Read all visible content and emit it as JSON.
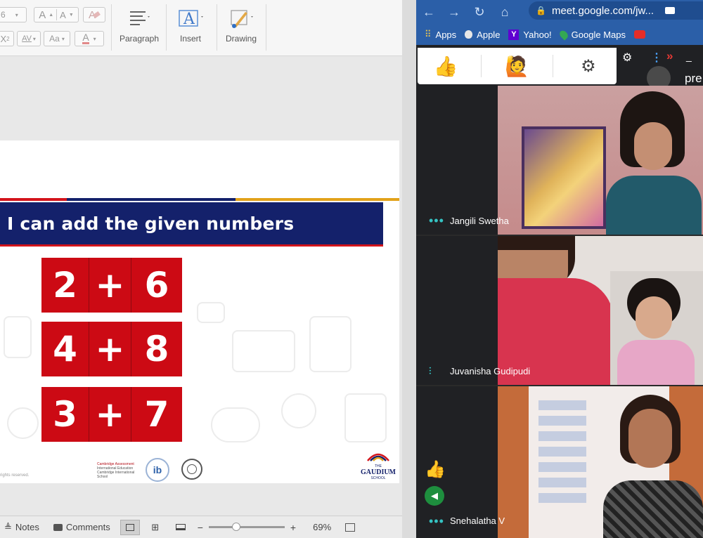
{
  "ppt": {
    "ribbon": {
      "font_size_value": "6",
      "grow_label": "A",
      "shrink_label": "A",
      "clear_label": "A",
      "sub_label": "X",
      "char_spacing_label": "AV",
      "change_case_label": "Aa",
      "font_color_label": "A",
      "paragraph_label": "Paragraph",
      "insert_label": "Insert",
      "drawing_label": "Drawing"
    },
    "slide": {
      "title": "I can add the given numbers",
      "equations": [
        {
          "a": "2",
          "op": "+",
          "b": "6"
        },
        {
          "a": "4",
          "op": "+",
          "b": "8"
        },
        {
          "a": "3",
          "op": "+",
          "b": "7"
        }
      ],
      "rights_note": "rights reserved.",
      "school_name": "GAUDIUM",
      "school_prefix": "THE",
      "school_suffix": "SCHOOL",
      "cambridge_line1": "Cambridge Assessment",
      "cambridge_line2": "International Education",
      "cambridge_line3": "Cambridge International School",
      "ib_label": "ib"
    },
    "statusbar": {
      "notes_label": "Notes",
      "comments_label": "Comments",
      "zoom_minus": "−",
      "zoom_plus": "+",
      "zoom_level": "69%",
      "zoom_fraction": 0.36
    }
  },
  "browser": {
    "url": "meet.google.com/jw...",
    "bookmarks": [
      {
        "label": "Apps",
        "icon": "apps-grid-icon"
      },
      {
        "label": "Apple",
        "icon": "apple-icon"
      },
      {
        "label": "Yahoo!",
        "icon": "yahoo-icon"
      },
      {
        "label": "Google Maps",
        "icon": "maps-pin-icon"
      }
    ],
    "presenting_label": "pre"
  },
  "meet": {
    "participants": [
      {
        "name": "Jangili Swetha",
        "indicator": "dots"
      },
      {
        "name": "Juvanisha Gudipudi",
        "indicator": "speaking"
      },
      {
        "name": "Snehalatha V",
        "indicator": "dots"
      }
    ]
  },
  "colors": {
    "slide_title_bg": "#14216b",
    "accent_red": "#cc0a14",
    "chrome_blue": "#2b5fa8",
    "meet_bg": "#202124",
    "meet_teal": "#35c3c3",
    "speaker_green": "#1e8e3e"
  }
}
